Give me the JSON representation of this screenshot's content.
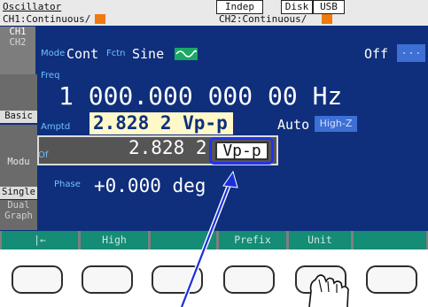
{
  "status_bar": {
    "title": "Oscillator",
    "indep": "Indep",
    "disk": "Disk",
    "usb": "USB",
    "ch1_state": "CH1:Continuous/",
    "ch2_state": "CH2:Continuous/",
    "indicator_color": "#f07a10"
  },
  "side_menu": {
    "ch1": "CH1",
    "ch2": "CH2",
    "basic": "Basic",
    "modu": "Modu",
    "single": "Single",
    "dual_1": "Dual",
    "dual_2": "Graph"
  },
  "params": {
    "mode_label": "Mode",
    "mode_value": "Cont",
    "fctn_label": "Fctn",
    "fctn_value": "Sine",
    "waveform_icon": "sine-wave-icon",
    "output_value": "Off",
    "more_label": "...",
    "freq_label": "Freq",
    "freq_value": "1 000.000 000 00 Hz",
    "amptd_label": "Amptd",
    "amptd_value": "2.828 2 Vp-p",
    "load_auto": "Auto",
    "load_value": "High-Z",
    "offset_label": "Of",
    "edit_value": "2.828 2",
    "unit_value": "Vp-p",
    "phase_label": "Phase",
    "phase_value": "+0.000 deg"
  },
  "softkeys": [
    "|←",
    "High",
    "",
    "Prefix",
    "Unit",
    ""
  ],
  "colors": {
    "screen_bg": "#0f2f7c",
    "label_blue": "#6fc0ff",
    "softkey_green": "#158c75",
    "highlight_box": "#2233ee",
    "amptd_bg": "#fff8c8"
  }
}
